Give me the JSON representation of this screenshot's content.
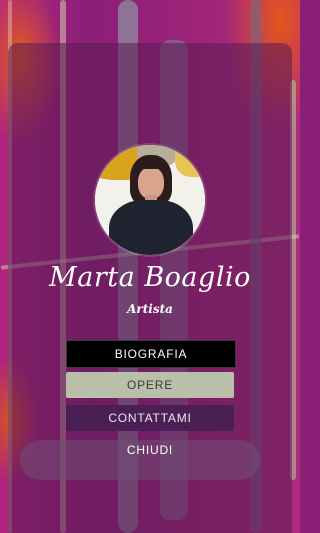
{
  "profile": {
    "name": "Marta Boaglio",
    "role": "Artista"
  },
  "menu": {
    "biografia": "BIOGRAFIA",
    "opere": "OPERE",
    "contattami": "CONTATTAMI",
    "chiudi": "CHIUDI"
  },
  "colors": {
    "background": "#8a1f78",
    "overlay": "#5a1c52",
    "bio_button": "#000000",
    "opere_button": "#b9bfa8",
    "contact_button": "#4a2054"
  }
}
